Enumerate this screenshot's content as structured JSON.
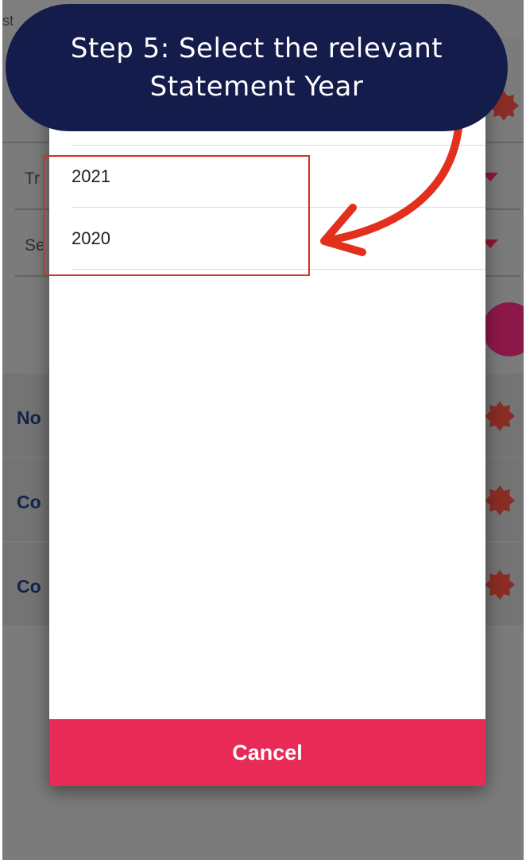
{
  "tutorial": {
    "step_line1": "Step 5: Select the relevant",
    "step_line2": "Statement Year"
  },
  "background": {
    "top_fragment": "st",
    "row1_fragment": "Tr",
    "row2_fragment": "Se",
    "sections": [
      "No",
      "Co",
      "Co"
    ]
  },
  "picker": {
    "years": [
      "2021",
      "2020"
    ],
    "cancel_label": "Cancel"
  },
  "colors": {
    "banner": "#141c4b",
    "cancel_button": "#e82a56",
    "highlight": "#d6301f",
    "arrow": "#e3301c",
    "brand_text": "#13244d"
  },
  "icons": [
    "gear-icon",
    "dropdown-caret-icon",
    "curved-arrow-icon"
  ]
}
